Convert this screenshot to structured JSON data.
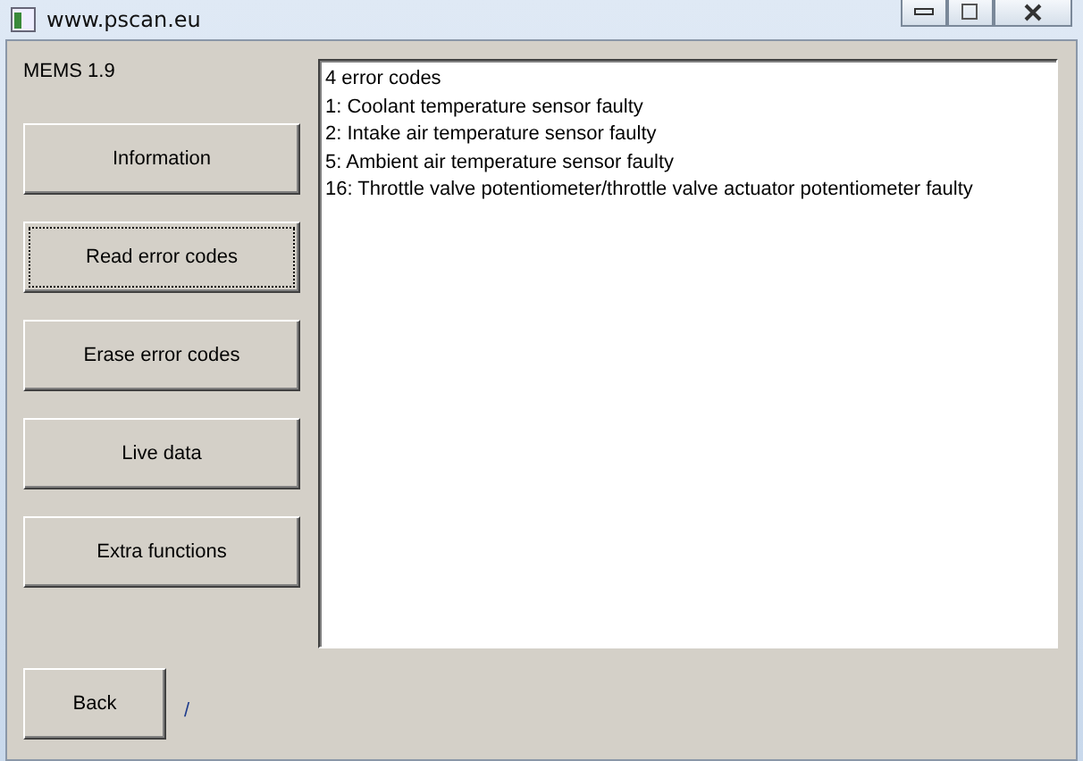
{
  "window": {
    "title": "www.pscan.eu"
  },
  "ecu_label": "MEMS 1.9",
  "menu_buttons": [
    {
      "label": "Information",
      "focused": false
    },
    {
      "label": "Read error codes",
      "focused": true
    },
    {
      "label": "Erase error codes",
      "focused": false
    },
    {
      "label": "Live data",
      "focused": false
    },
    {
      "label": "Extra functions",
      "focused": false
    }
  ],
  "output_lines": [
    "4 error codes",
    "1: Coolant temperature sensor faulty",
    "2: Intake air temperature sensor faulty",
    "5: Ambient air temperature sensor faulty",
    "16: Throttle valve potentiometer/throttle valve actuator potentiometer faulty"
  ],
  "back_button": {
    "label": "Back"
  },
  "status_text": "/"
}
